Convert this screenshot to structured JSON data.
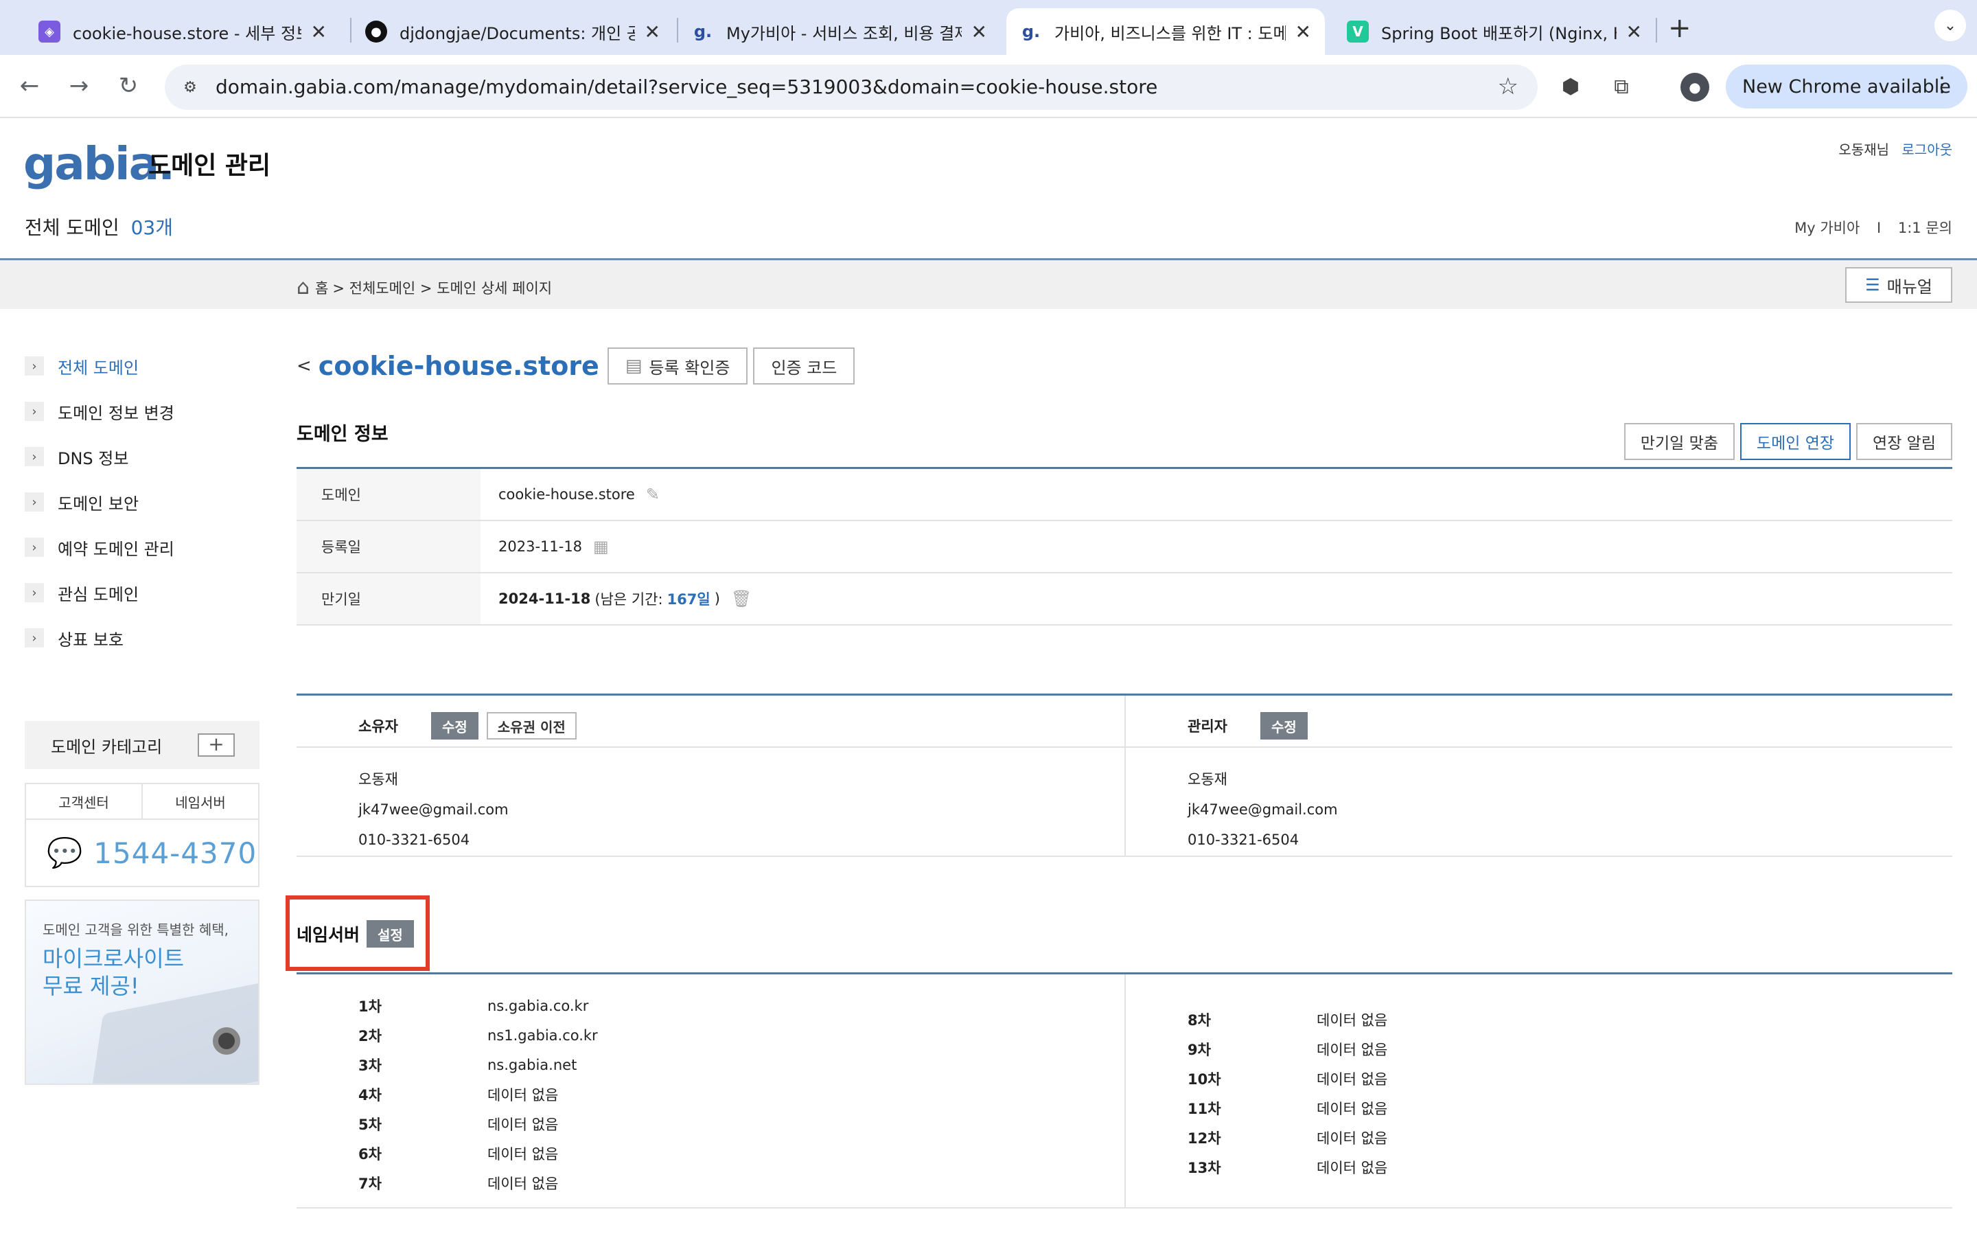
{
  "browser": {
    "tabs": [
      {
        "title": "cookie-house.store - 세부 정보",
        "favicon": "purple-badge-icon"
      },
      {
        "title": "djdongjae/Documents: 개인 공",
        "favicon": "github-icon"
      },
      {
        "title": "My가비아 - 서비스 조회, 비용 결제",
        "favicon": "gabia-g-icon"
      },
      {
        "title": "가비아, 비즈니스를 위한 IT : 도메인",
        "favicon": "gabia-g-icon",
        "active": true
      },
      {
        "title": "Spring Boot 배포하기 (Nginx, H",
        "favicon": "velog-v-icon"
      }
    ],
    "url": "domain.gabia.com/manage/mydomain/detail?service_seq=5319003&domain=cookie-house.store",
    "new_chrome_label": "New Chrome available"
  },
  "header": {
    "logo_text": "gabia.",
    "service_title": "도메인 관리",
    "user_name": "오동재님",
    "logout": "로그아웃",
    "total_domain_label": "전체 도메인",
    "total_domain_count": "03개",
    "my_gabia": "My 가비아",
    "divider": "I",
    "inquiry": "1:1 문의"
  },
  "breadcrumb": {
    "home": "홈",
    "path": "> 전체도메인 > 도메인 상세 페이지",
    "manual_label": "매뉴얼"
  },
  "sidebar": {
    "items": [
      {
        "label": "전체 도메인",
        "active": true
      },
      {
        "label": "도메인 정보 변경"
      },
      {
        "label": "DNS 정보"
      },
      {
        "label": "도메인 보안"
      },
      {
        "label": "예약 도메인 관리"
      },
      {
        "label": "관심 도메인"
      },
      {
        "label": "상표 보호"
      }
    ],
    "category_label": "도메인 카테고리",
    "category_plus": "+",
    "support_tabs": [
      "고객센터",
      "네임서버"
    ],
    "phone": "1544-4370",
    "promo_small": "도메인 고객을 위한 특별한 혜택,",
    "promo_big_line1": "마이크로사이트",
    "promo_big_line2": "무료 제공!"
  },
  "main": {
    "back": "<",
    "domain_name": "cookie-house.store",
    "reg_cert_button": "등록 확인증",
    "auth_code_button": "인증 코드",
    "domain_info_heading": "도메인 정보",
    "actions": {
      "match_expiry": "만기일 맞춤",
      "renew": "도메인 연장",
      "renew_alert": "연장 알림"
    },
    "info": {
      "domain_label": "도메인",
      "domain_value": "cookie-house.store",
      "reg_label": "등록일",
      "reg_value": "2023-11-18",
      "exp_label": "만기일",
      "exp_value": "2024-11-18",
      "exp_remaining_prefix": "(남은 기간:",
      "exp_remaining_days": "167일",
      "exp_remaining_suffix": ")"
    },
    "owner": {
      "label": "소유자",
      "edit": "수정",
      "transfer": "소유권 이전",
      "name": "오동재",
      "email": "jk47wee@gmail.com",
      "phone": "010-3321-6504"
    },
    "admin": {
      "label": "관리자",
      "edit": "수정",
      "name": "오동재",
      "email": "jk47wee@gmail.com",
      "phone": "010-3321-6504"
    },
    "nameserver": {
      "heading": "네임서버",
      "setting": "설정",
      "left": [
        {
          "n": "1차",
          "server": "ns.gabia.co.kr"
        },
        {
          "n": "2차",
          "server": "ns1.gabia.co.kr"
        },
        {
          "n": "3차",
          "server": "ns.gabia.net"
        },
        {
          "n": "4차",
          "server": "데이터 없음"
        },
        {
          "n": "5차",
          "server": "데이터 없음"
        },
        {
          "n": "6차",
          "server": "데이터 없음"
        },
        {
          "n": "7차",
          "server": "데이터 없음"
        }
      ],
      "right": [
        {
          "n": "8차",
          "server": "데이터 없음"
        },
        {
          "n": "9차",
          "server": "데이터 없음"
        },
        {
          "n": "10차",
          "server": "데이터 없음"
        },
        {
          "n": "11차",
          "server": "데이터 없음"
        },
        {
          "n": "12차",
          "server": "데이터 없음"
        },
        {
          "n": "13차",
          "server": "데이터 없음"
        }
      ]
    }
  },
  "colors": {
    "accent_blue": "#2c6fb7",
    "highlight_red": "#e33b2e",
    "gray_button": "#767e88"
  }
}
